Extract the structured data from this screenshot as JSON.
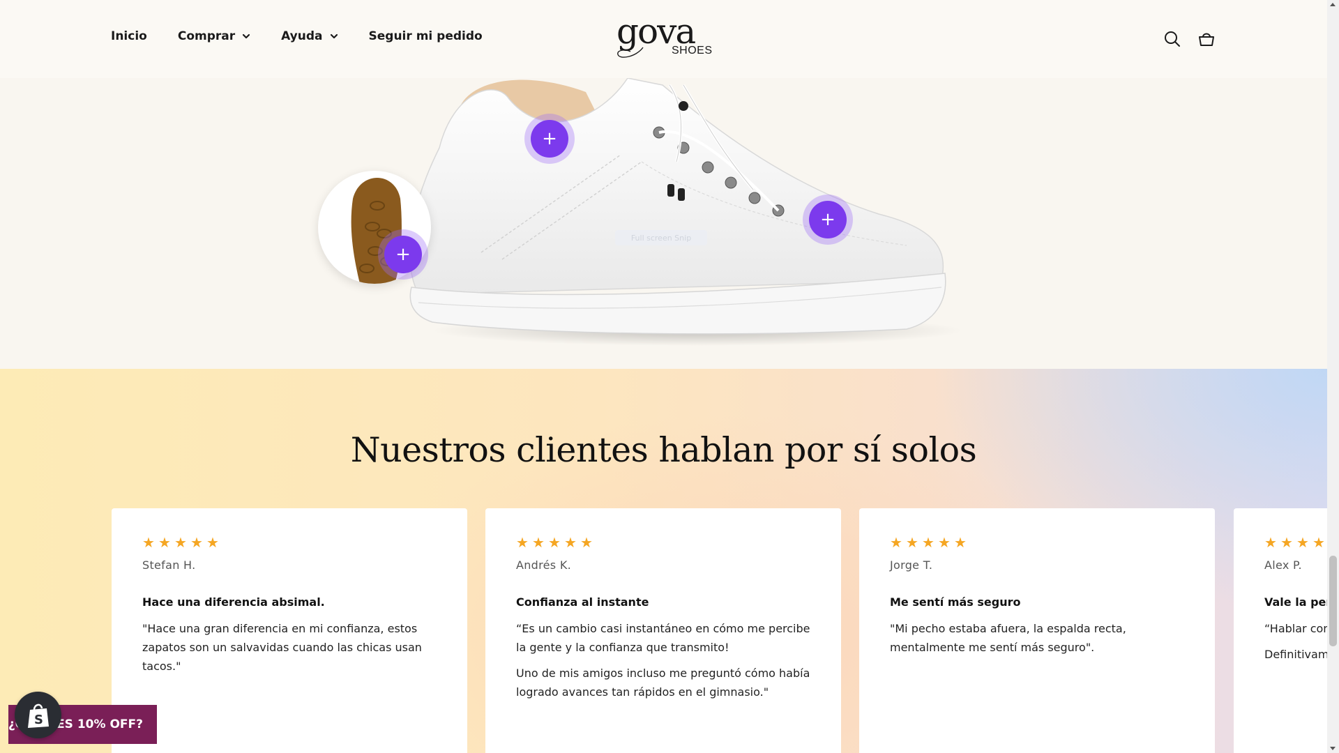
{
  "header": {
    "nav": [
      {
        "label": "Inicio",
        "has_dropdown": false
      },
      {
        "label": "Comprar",
        "has_dropdown": true
      },
      {
        "label": "Ayuda",
        "has_dropdown": true
      },
      {
        "label": "Seguir mi pedido",
        "has_dropdown": false
      }
    ],
    "logo": {
      "wordmark": "gova",
      "sub": "SHOES"
    },
    "icons": [
      "search-icon",
      "cart-icon"
    ]
  },
  "hero": {
    "hotspot_label": "+",
    "fullscreen_tag": "Full screen Snip",
    "accent_color": "#7c3aed"
  },
  "reviews": {
    "title": "Nuestros clientes hablan por sí solos",
    "star_color": "#f5a623",
    "cards": [
      {
        "rating": 5,
        "author": "Stefan H.",
        "title": "Hace una diferencia absimal.",
        "body": [
          "\"Hace una gran diferencia en mi confianza, estos zapatos son un salvavidas cuando las chicas usan tacos.\""
        ]
      },
      {
        "rating": 5,
        "author": "Andrés K.",
        "title": "Confianza al instante",
        "body": [
          "“Es un cambio casi instantáneo en cómo me percibe la gente y la confianza que transmito!",
          "Uno de mis amigos incluso me preguntó cómo había logrado avances tan rápidos en el gimnasio.\""
        ]
      },
      {
        "rating": 5,
        "author": "Jorge T.",
        "title": "Me sentí más seguro",
        "body": [
          "\"Mi pecho estaba afuera, la espalda recta, mentalmente me sentí más seguro\"."
        ]
      },
      {
        "rating": 5,
        "author": "Alex P.",
        "title": "Vale la pena",
        "body": [
          "“Hablar con indescriptible mejor.",
          "Definitivamente"
        ]
      }
    ]
  },
  "promo": {
    "label": "¿QUIERES 10% OFF?",
    "color": "#7a1f57"
  }
}
